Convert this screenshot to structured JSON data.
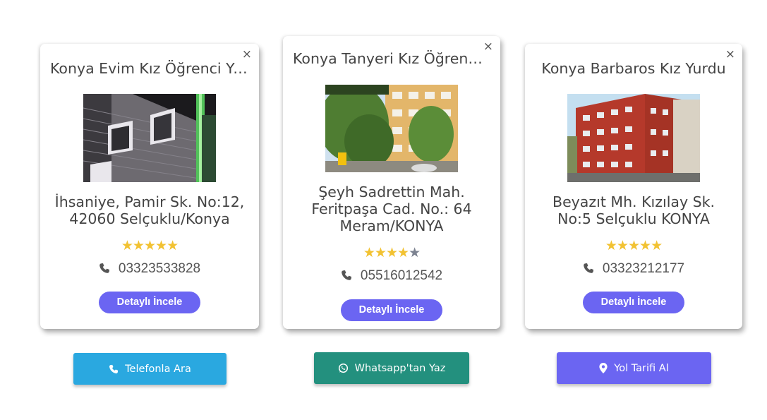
{
  "cards": [
    {
      "title": "Konya Evim Kız Öğrenci Yurdu",
      "close_label": "×",
      "address_line1": "İhsaniye, Pamir Sk. No:12,",
      "address_line2": "42060 Selçuklu/Konya",
      "address_line3": "",
      "rating": 5,
      "phone": "03323533828",
      "detail_label": "Detaylı İncele"
    },
    {
      "title": "Konya Tanyeri Kız Öğrenci Yurdu",
      "close_label": "×",
      "address_line1": "Şeyh Sadrettin Mah.",
      "address_line2": "Feritpaşa Cad. No.: 64",
      "address_line3": "Meram/KONYA",
      "rating": 4,
      "phone": "05516012542",
      "detail_label": "Detaylı İncele"
    },
    {
      "title": "Konya Barbaros Kız Yurdu",
      "close_label": "×",
      "address_line1": "Beyazıt Mh. Kızılay Sk.",
      "address_line2": "No:5 Selçuklu KONYA",
      "address_line3": "",
      "rating": 5,
      "phone": "03323212177",
      "detail_label": "Detaylı İncele"
    }
  ],
  "actions": {
    "call_label": "Telefonla Ara",
    "whatsapp_label": "Whatsapp'tan Yaz",
    "directions_label": "Yol Tarifi Al"
  },
  "colors": {
    "accent": "#6b65f2",
    "call": "#2aa8e0",
    "whatsapp": "#23907e",
    "directions": "#6b65f2",
    "star_on": "#f2c232",
    "star_off": "#7c8290"
  },
  "icons": [
    "close-icon",
    "phone-icon",
    "star-icon",
    "whatsapp-icon",
    "map-marker-icon"
  ]
}
